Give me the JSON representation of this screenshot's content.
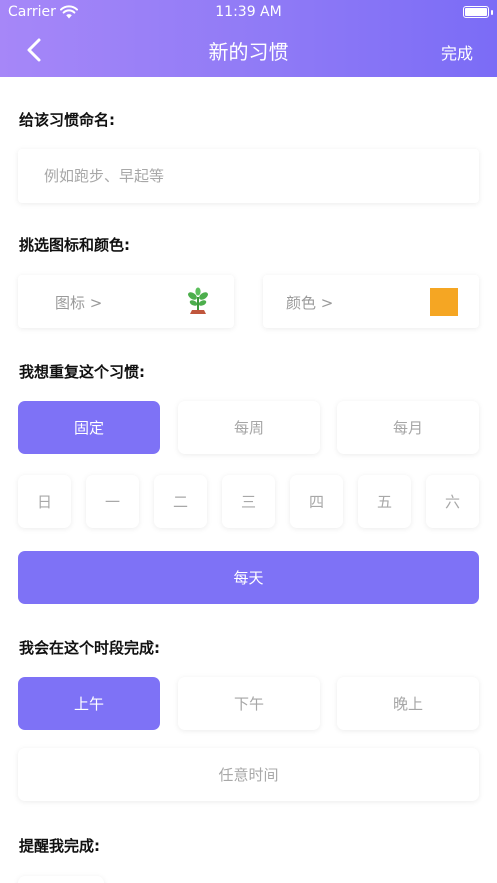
{
  "status_bar": {
    "carrier": "Carrier",
    "time": "11:39 AM"
  },
  "nav": {
    "title": "新的习惯",
    "done_label": "完成"
  },
  "name_section": {
    "label": "给该习惯命名:",
    "placeholder": "例如跑步、早起等"
  },
  "appearance_section": {
    "label": "挑选图标和颜色:",
    "icon_label": "图标 >",
    "icon_name": "sprout-icon",
    "color_label": "颜色 >",
    "selected_color": "#f5a623"
  },
  "repeat_section": {
    "label": "我想重复这个习惯:",
    "modes": [
      {
        "label": "固定",
        "active": true
      },
      {
        "label": "每周",
        "active": false
      },
      {
        "label": "每月",
        "active": false
      }
    ],
    "days": [
      "日",
      "一",
      "二",
      "三",
      "四",
      "五",
      "六"
    ],
    "everyday_label": "每天"
  },
  "time_section": {
    "label": "我会在这个时段完成:",
    "slots": [
      {
        "label": "上午",
        "active": true
      },
      {
        "label": "下午",
        "active": false
      },
      {
        "label": "晚上",
        "active": false
      }
    ],
    "anytime_label": "任意时间"
  },
  "remind_section": {
    "label": "提醒我完成:"
  },
  "colors": {
    "accent": "#7e72f6",
    "header_gradient_start": "#a687f8",
    "header_gradient_end": "#7b6cf6",
    "swatch": "#f5a623"
  }
}
